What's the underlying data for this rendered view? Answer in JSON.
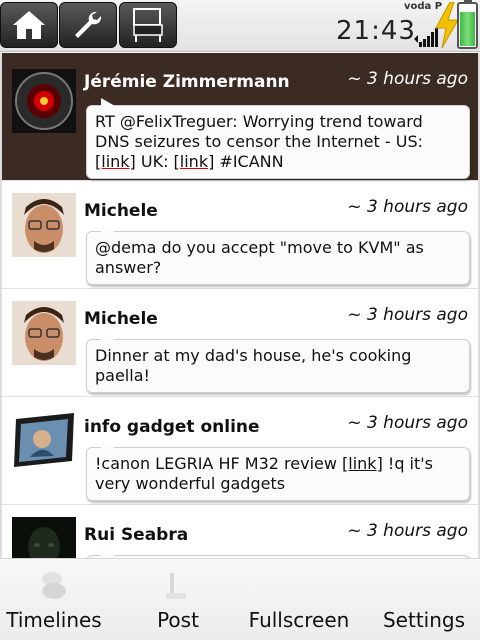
{
  "status": {
    "time": "21:43",
    "operator": "voda P",
    "battery_level_percent": 80
  },
  "toolbar_top": [
    {
      "icon": "home-icon"
    },
    {
      "icon": "wrench-icon"
    },
    {
      "icon": "chair-icon"
    }
  ],
  "timeline": [
    {
      "author": "Jérémie Zimmermann",
      "time": "~ 3 hours ago",
      "avatar": "hal-9000-avatar",
      "text_parts": [
        "RT @FelixTreguer: Worrying trend toward DNS seizures to censor the Internet - US: ",
        "[link]",
        " UK: ",
        "[link]",
        " #ICANN"
      ],
      "selected": true
    },
    {
      "author": "Michele",
      "time": "~ 3 hours ago",
      "avatar": "man-glasses-avatar",
      "text": "@dema do you accept \"move to KVM\" as answer?"
    },
    {
      "author": "Michele",
      "time": "~ 3 hours ago",
      "avatar": "man-glasses-avatar",
      "text": "Dinner at my dad's house, he's cooking paella!"
    },
    {
      "author": "info gadget online",
      "time": "~ 3 hours ago",
      "avatar": "tablet-avatar",
      "text_parts": [
        "!canon LEGRIA HF M32 review ",
        "[link]",
        " !q it's very wonderful gadgets"
      ]
    },
    {
      "author": "Rui Seabra",
      "time": "~ 3 hours ago",
      "avatar": "dark-face-avatar",
      "text": ""
    }
  ],
  "bottom_bar": {
    "timelines": "Timelines",
    "post": "Post",
    "fullscreen": "Fullscreen",
    "settings": "Settings"
  },
  "colors": {
    "selected_row": "#3b2b23",
    "link_underline": "#d00000",
    "battery": "#3fb53f"
  }
}
